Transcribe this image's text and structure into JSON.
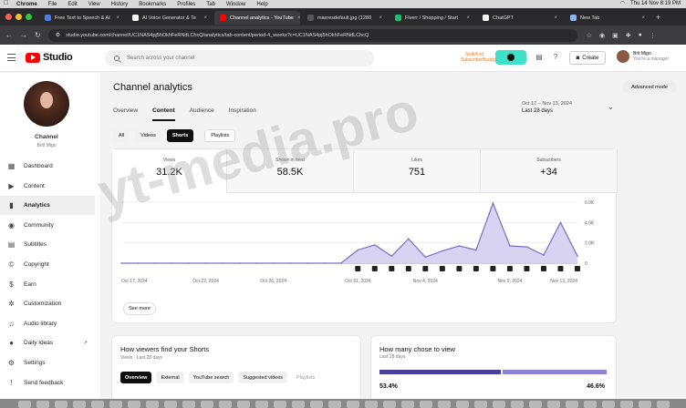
{
  "menubar": {
    "app": "Chrome",
    "items": [
      "File",
      "Edit",
      "View",
      "History",
      "Bookmarks",
      "Profiles",
      "Tab",
      "Window",
      "Help"
    ],
    "clock": "Thu 14 Nov 8:19 PM"
  },
  "browser": {
    "tabs": [
      {
        "label": "Free Text to Speech & AI",
        "color": "#4a7be8",
        "active": false
      },
      {
        "label": "AI Voice Generator & Te",
        "color": "#ffffff",
        "active": false
      },
      {
        "label": "Channel analytics - YouTube",
        "color": "#ff0000",
        "active": true
      },
      {
        "label": "maxresdefault.jpg (1280",
        "color": "#555555",
        "active": false
      },
      {
        "label": "Fiverr / Shopping / Start",
        "color": "#1dbf73",
        "active": false
      },
      {
        "label": "ChatGPT",
        "color": "#ffffff",
        "active": false
      },
      {
        "label": "New Tab",
        "color": "#8ab4f8",
        "active": false
      }
    ],
    "url": "studio.youtube.com/channel/UC1NAS4pj5hOkhFeRNdLChcQ/analytics/tab-content/period-4_weeks?c=UC1NAS4pj5hOkhFeRNdLChcQ"
  },
  "header": {
    "brand": "Studio",
    "search_placeholder": "Search across your channel",
    "subbuddy": "Switch to SubscriberBuddy",
    "create": "Create",
    "user_name": "Brit Migo",
    "user_role": "You're a manager"
  },
  "sidebar": {
    "channel_label": "Channel",
    "channel_name": "Britt Migo",
    "items": [
      {
        "label": "Dashboard",
        "icon": "▦",
        "active": false
      },
      {
        "label": "Content",
        "icon": "▶",
        "active": false
      },
      {
        "label": "Analytics",
        "icon": "▮",
        "active": true
      },
      {
        "label": "Community",
        "icon": "◉",
        "active": false
      },
      {
        "label": "Subtitles",
        "icon": "▤",
        "active": false
      },
      {
        "label": "Copyright",
        "icon": "©",
        "active": false
      },
      {
        "label": "Earn",
        "icon": "$",
        "active": false
      },
      {
        "label": "Customization",
        "icon": "✲",
        "active": false
      },
      {
        "label": "Audio library",
        "icon": "♫",
        "active": false
      },
      {
        "label": "Daily Ideas",
        "icon": "●",
        "active": false,
        "ext": "↗"
      },
      {
        "label": "Settings",
        "icon": "⚙",
        "active": false
      },
      {
        "label": "Send feedback",
        "icon": "!",
        "active": false
      }
    ]
  },
  "analytics": {
    "title": "Channel analytics",
    "tabs": [
      "Overview",
      "Content",
      "Audience",
      "Inspiration"
    ],
    "selected_tab": "Content",
    "advanced": "Advanced mode",
    "date_range": "Oct 17 – Nov 13, 2024",
    "period": "Last 28 days",
    "chips": [
      "All",
      "Videos",
      "Shorts"
    ],
    "selected_chip": "Shorts",
    "playlists": "Playlists",
    "metrics": [
      {
        "label": "Views",
        "value": "31.2K"
      },
      {
        "label": "Shown in feed",
        "value": "58.5K"
      },
      {
        "label": "Likes",
        "value": "751"
      },
      {
        "label": "Subscribers",
        "value": "+34"
      }
    ],
    "see_more": "See more"
  },
  "chart_data": {
    "type": "area",
    "x": [
      "Oct 17",
      "Oct 18",
      "Oct 19",
      "Oct 20",
      "Oct 21",
      "Oct 22",
      "Oct 23",
      "Oct 24",
      "Oct 25",
      "Oct 26",
      "Oct 27",
      "Oct 28",
      "Oct 29",
      "Oct 30",
      "Oct 31",
      "Nov 1",
      "Nov 2",
      "Nov 3",
      "Nov 4",
      "Nov 5",
      "Nov 6",
      "Nov 7",
      "Nov 8",
      "Nov 9",
      "Nov 10",
      "Nov 11",
      "Nov 12",
      "Nov 13"
    ],
    "values": [
      0,
      0,
      0,
      0,
      0,
      0,
      0,
      0,
      0,
      0,
      0,
      0,
      0,
      0,
      1300,
      1800,
      700,
      2400,
      600,
      1200,
      1700,
      1300,
      5900,
      1700,
      1600,
      800,
      4000,
      700
    ],
    "xticks": [
      "Oct 17, 2024",
      "Oct 22, 2024",
      "Oct 26, 2024",
      "Oct 31, 2024",
      "Nov 4, 2024",
      "Nov 9, 2024",
      "Nov 13, 2024"
    ],
    "yticks": [
      "0",
      "2.0K",
      "4.0K",
      "6.0K"
    ],
    "ylim": [
      0,
      6000
    ],
    "grid": true,
    "fill": "#d8d3f0",
    "line": "#7a6fc4"
  },
  "how_find": {
    "title": "How viewers find your Shorts",
    "subtitle": "Views · Last 28 days",
    "tabs": [
      "Overview",
      "External",
      "YouTube search",
      "Suggested videos",
      "Playlists"
    ]
  },
  "how_chose": {
    "title": "How many chose to view",
    "subtitle": "Last 28 days",
    "viewed": 53.4,
    "swiped": 46.6,
    "viewed_label": "53.4%",
    "swiped_label": "46.6%"
  },
  "watermark": "yt-media.pro"
}
